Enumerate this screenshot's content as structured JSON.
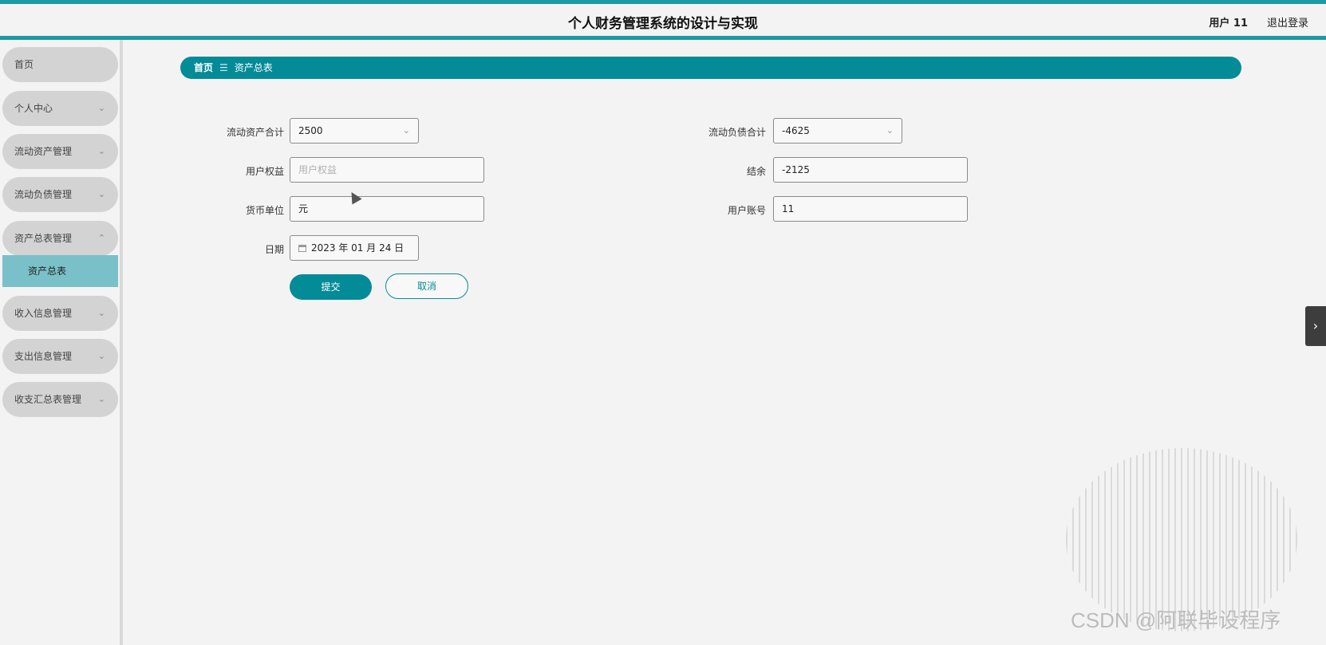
{
  "header": {
    "title": "个人财务管理系统的设计与实现",
    "user": "用户 11",
    "logout": "退出登录"
  },
  "sidebar": {
    "items": [
      {
        "label": "首页",
        "chevron": ""
      },
      {
        "label": "个人中心",
        "chevron": "⌄"
      },
      {
        "label": "流动资产管理",
        "chevron": "⌄"
      },
      {
        "label": "流动负债管理",
        "chevron": "⌄"
      },
      {
        "label": "资产总表管理",
        "chevron": "⌃"
      },
      {
        "label": "收入信息管理",
        "chevron": "⌄"
      },
      {
        "label": "支出信息管理",
        "chevron": "⌄"
      },
      {
        "label": "收支汇总表管理",
        "chevron": "⌄"
      }
    ],
    "active_sub": "资产总表"
  },
  "breadcrumb": {
    "home": "首页",
    "sep": "☰",
    "current": "资产总表"
  },
  "form": {
    "current_assets_label": "流动资产合计",
    "current_assets_value": "2500",
    "current_liab_label": "流动负债合计",
    "current_liab_value": "-4625",
    "equity_label": "用户权益",
    "equity_placeholder": "用户权益",
    "balance_label": "结余",
    "balance_value": "-2125",
    "currency_label": "货币单位",
    "currency_value": "元",
    "account_label": "用户账号",
    "account_value": "11",
    "date_label": "日期",
    "date_value": "2023 年 01 月 24 日"
  },
  "buttons": {
    "submit": "提交",
    "cancel": "取消"
  },
  "watermark": "CSDN @阿联毕设程序",
  "colors": {
    "accent": "#048b98",
    "topline": "#1d9aa3",
    "active_sub_bg": "#7ac0c8"
  }
}
